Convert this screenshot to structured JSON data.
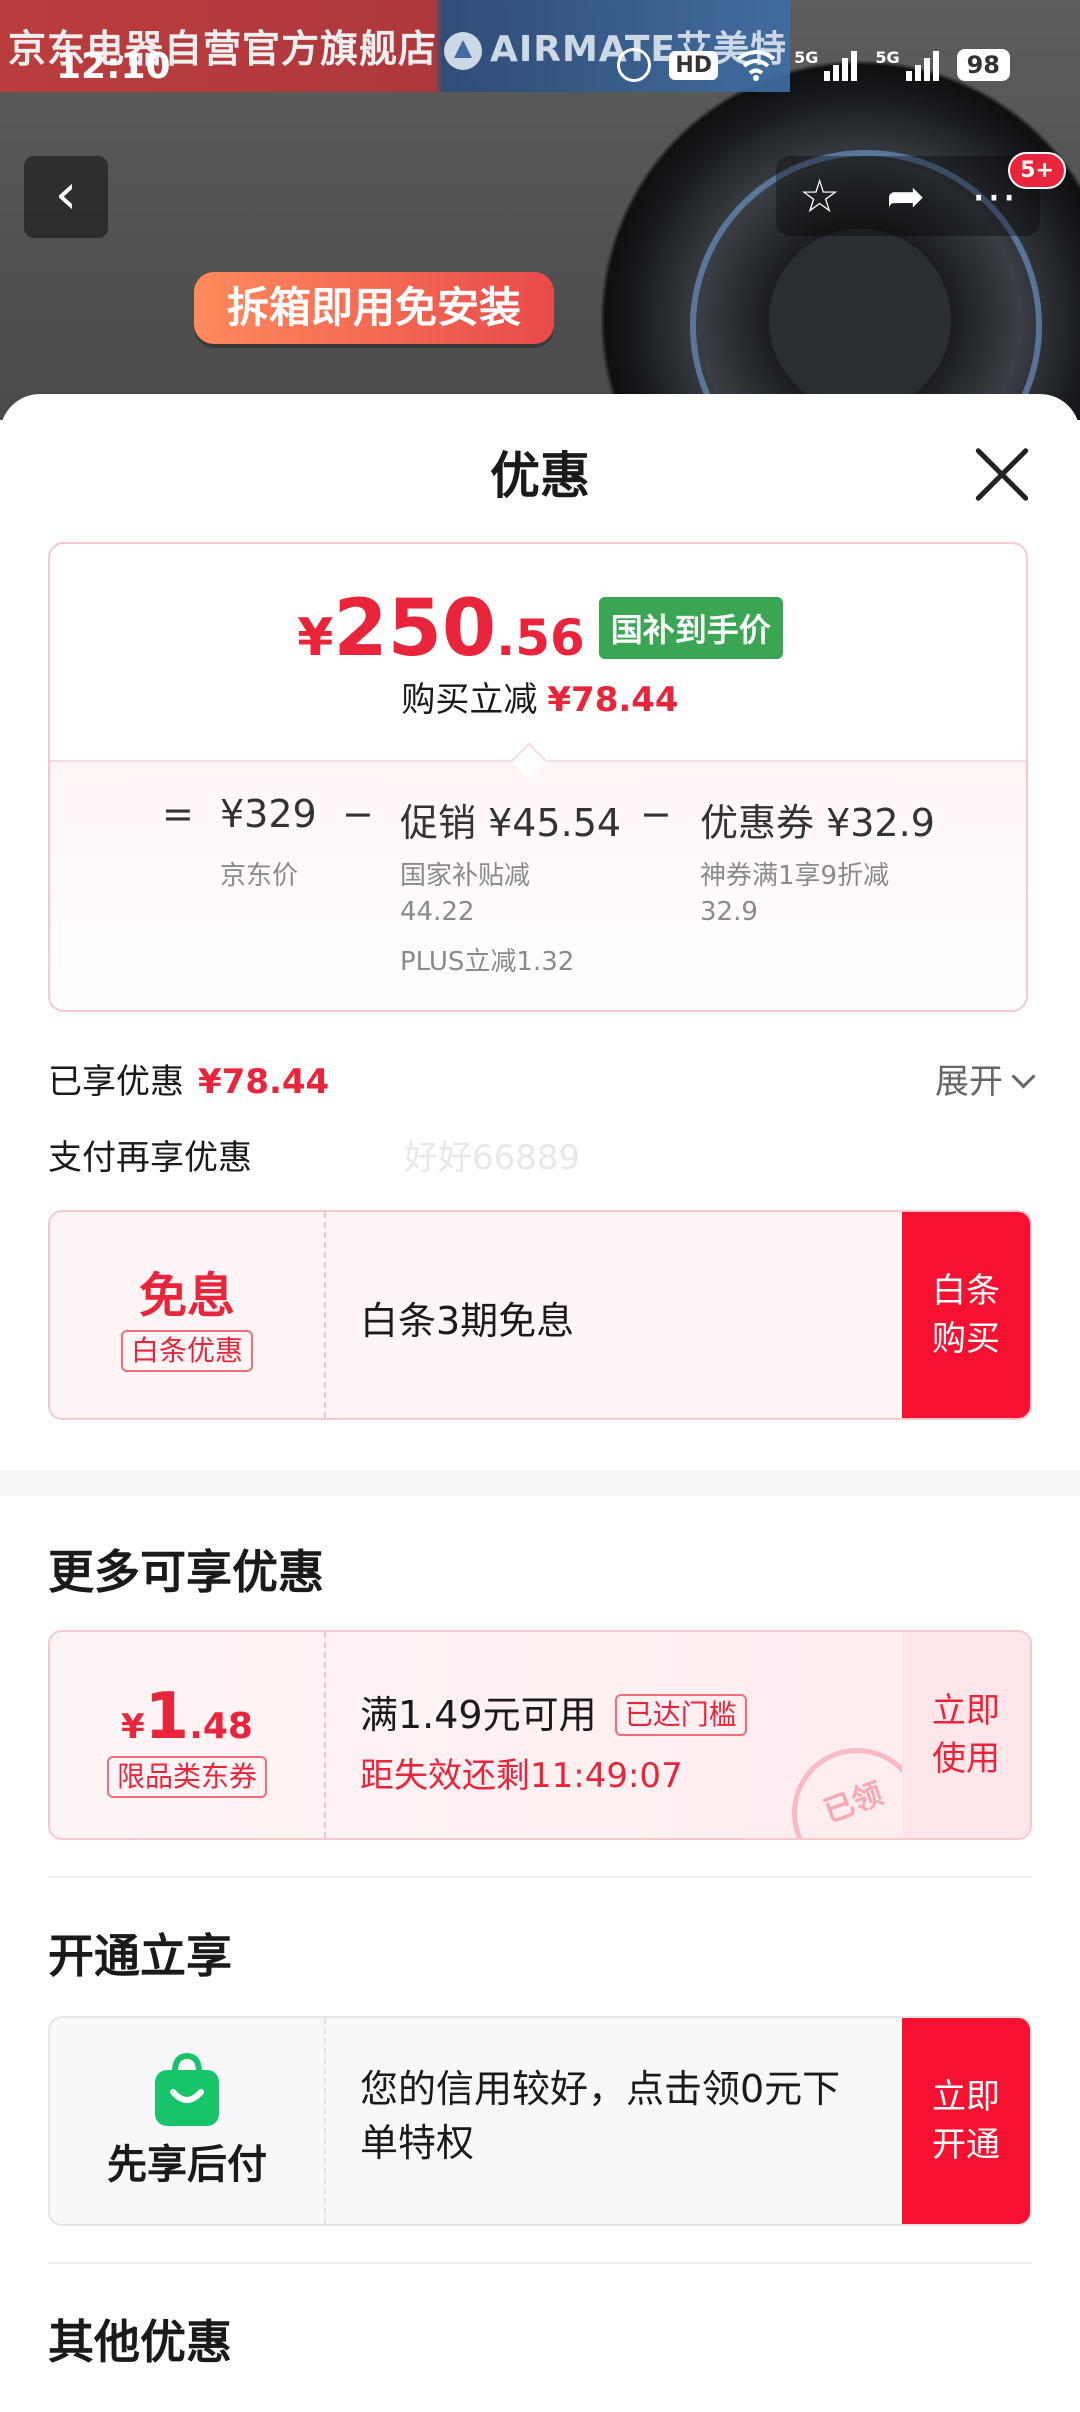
{
  "status_bar": {
    "time": "12:10",
    "hd": "HD",
    "net1": "5G",
    "net2": "5G",
    "battery": "98"
  },
  "hero": {
    "store_banner": "京东电器自营官方旗舰店",
    "brand_banner": "AIRMATE艾美特",
    "promo_tag": "拆箱即用免安装",
    "badge": "5+"
  },
  "sheet": {
    "title": "优惠",
    "price": {
      "yen": "¥",
      "int": "250",
      "dec": ".56",
      "tag": "国补到手价"
    },
    "reduce_label": "购买立减",
    "reduce_value": "¥78.44",
    "calc": {
      "eq": "=",
      "jd_price": "¥329",
      "jd_price_label": "京东价",
      "minus1": "−",
      "promo": "促销 ¥45.54",
      "promo_note1": "国家补贴减",
      "promo_note2": "44.22",
      "promo_note3": "PLUS立减1.32",
      "minus2": "−",
      "coupon": "优惠券 ¥32.9",
      "coupon_note1": "神券满1享9折减",
      "coupon_note2": "32.9"
    },
    "enjoyed_label": "已享优惠",
    "enjoyed_value": "¥78.44",
    "expand": "展开",
    "pay_more": "支付再享优惠",
    "watermark": "好好66889",
    "baitiao": {
      "title": "免息",
      "tag": "白条优惠",
      "desc": "白条3期免息",
      "btn": "白条购买"
    },
    "more_title": "更多可享优惠",
    "coupon": {
      "yen": "¥",
      "int": "1",
      "dec": ".48",
      "tag": "限品类东券",
      "cond": "满1.49元可用",
      "cond_tag": "已达门槛",
      "expire": "距失效还剩11:49:07",
      "stamp": "已领",
      "btn": "立即使用"
    },
    "open_title": "开通立享",
    "paylater": {
      "name": "先享后付",
      "desc": "您的信用较好，点击领0元下单特权",
      "btn": "立即开通"
    },
    "other_title": "其他优惠"
  },
  "colors": {
    "accent": "#e8253a",
    "button": "#f5112f",
    "green_tag": "#3aa653",
    "app_green": "#18c46a"
  }
}
